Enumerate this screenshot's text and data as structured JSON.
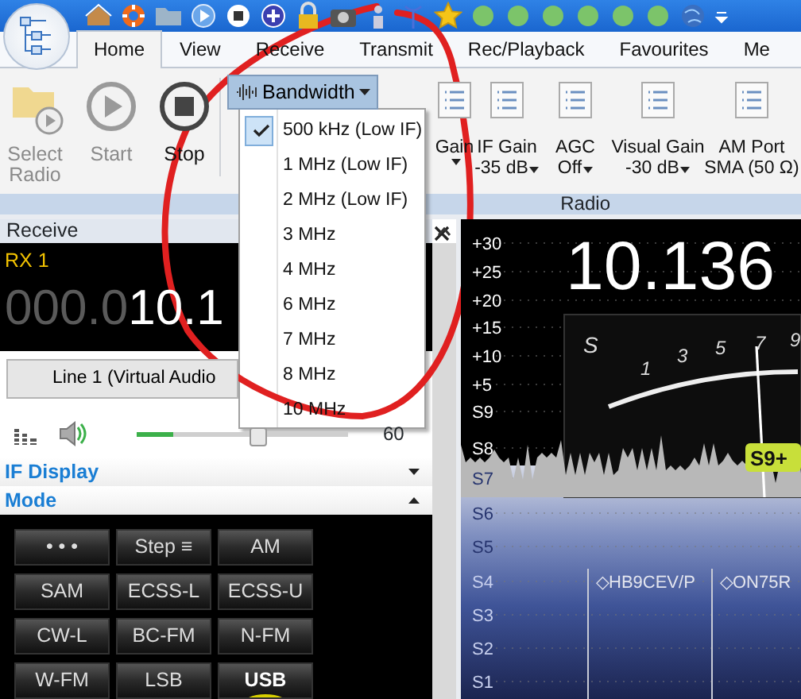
{
  "tabs": [
    {
      "label": "Home",
      "selected": true
    },
    {
      "label": "View",
      "selected": false
    },
    {
      "label": "Receive",
      "selected": false
    },
    {
      "label": "Transmit",
      "selected": false
    },
    {
      "label": "Rec/Playback",
      "selected": false
    },
    {
      "label": "Favourites",
      "selected": false
    },
    {
      "label": "Me",
      "selected": false
    }
  ],
  "ribbon": {
    "buttons": [
      {
        "label": "Select Radio",
        "disabled": true
      },
      {
        "label": "Start",
        "disabled": true
      },
      {
        "label": "Stop",
        "disabled": false
      }
    ],
    "bandwidth": {
      "label": "Bandwidth",
      "expanded": true
    },
    "controls": [
      {
        "label": "Gain",
        "dropdown": true
      },
      {
        "label": "IF Gain",
        "value": "-35 dB",
        "dropdown": true
      },
      {
        "label": "AGC",
        "value": "Off",
        "dropdown": true
      },
      {
        "label": "Visual Gain",
        "value": "-30 dB",
        "dropdown": true
      },
      {
        "label": "AM Port",
        "value": "SMA (50 Ω)",
        "dropdown": false
      }
    ],
    "group_label": "Radio"
  },
  "bandwidth_menu": [
    {
      "label": "500 kHz (Low IF)",
      "selected": true
    },
    {
      "label": "1 MHz (Low IF)",
      "selected": false
    },
    {
      "label": "2 MHz (Low IF)",
      "selected": false
    },
    {
      "label": "3 MHz",
      "selected": false
    },
    {
      "label": "4 MHz",
      "selected": false
    },
    {
      "label": "6 MHz",
      "selected": false
    },
    {
      "label": "7 MHz",
      "selected": false
    },
    {
      "label": "8 MHz",
      "selected": false
    },
    {
      "label": "10 MHz",
      "selected": false
    }
  ],
  "receive_panel": {
    "title": "Receive",
    "rx_label": "RX 1",
    "frequency_dim": "000.0",
    "frequency_bright": "10.1",
    "audio_device": "Line 1 (Virtual Audio",
    "audio_meter": {
      "level": 0.17
    },
    "volume": {
      "level": 0.57,
      "reading": "60"
    },
    "sections": [
      {
        "label": "IF Display",
        "expanded": false
      },
      {
        "label": "Mode",
        "expanded": true
      }
    ],
    "modes": [
      {
        "label": "• • •",
        "selected": false
      },
      {
        "label": "Step ≡",
        "selected": false
      },
      {
        "label": "AM",
        "selected": false
      },
      {
        "label": "SAM",
        "selected": false
      },
      {
        "label": "ECSS-L",
        "selected": false
      },
      {
        "label": "ECSS-U",
        "selected": false
      },
      {
        "label": "CW-L",
        "selected": false
      },
      {
        "label": "BC-FM",
        "selected": false
      },
      {
        "label": "N-FM",
        "selected": false
      },
      {
        "label": "W-FM",
        "selected": false
      },
      {
        "label": "LSB",
        "selected": false
      },
      {
        "label": "USB",
        "selected": true
      }
    ]
  },
  "spectrum": {
    "frequency": "10.136",
    "scale": [
      "+30",
      "+25",
      "+20",
      "+15",
      "+10",
      "+5",
      "S9",
      "S8",
      "S7",
      "S6",
      "S5",
      "S4",
      "S3",
      "S2",
      "S1"
    ],
    "meter_scale": [
      "S",
      "1",
      "3",
      "5",
      "7",
      "9"
    ],
    "meter_reading": "S9+",
    "stations": [
      "◇HB9CEV/P",
      "◇ON75R"
    ]
  }
}
